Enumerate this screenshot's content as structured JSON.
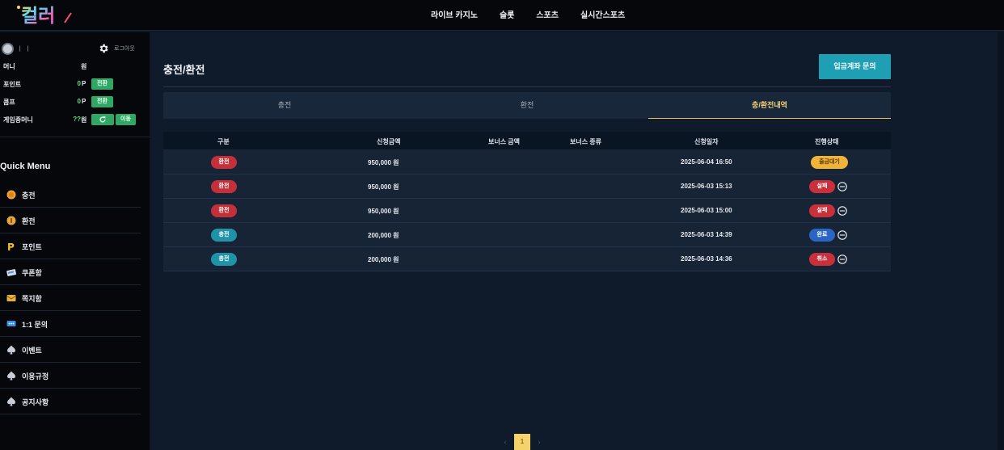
{
  "header": {
    "logo_text": "컬러",
    "nav": [
      "라이브 카지노",
      "슬롯",
      "스포츠",
      "실시간스포츠"
    ]
  },
  "sidebar": {
    "username": "ㅣ ㅣ",
    "logout": "로그아웃",
    "balances": [
      {
        "label": "머니",
        "value": "",
        "unit": "원"
      },
      {
        "label": "포인트",
        "value": "0",
        "unit": "P",
        "button": "전환"
      },
      {
        "label": "콤프",
        "value": "0",
        "unit": "P",
        "button": "전환"
      },
      {
        "label": "게임중머니",
        "value": "??",
        "unit": "원",
        "button": "이동"
      }
    ],
    "quick_menu_title": "Quick Menu",
    "quick_menu": [
      {
        "label": "충전",
        "icon": "coin-icon"
      },
      {
        "label": "환전",
        "icon": "coin-icon"
      },
      {
        "label": "포인트",
        "icon": "point-icon"
      },
      {
        "label": "쿠폰함",
        "icon": "coupon-icon"
      },
      {
        "label": "쪽지함",
        "icon": "message-icon"
      },
      {
        "label": "1:1 문의",
        "icon": "chat-icon"
      },
      {
        "label": "이벤트",
        "icon": "spade-icon"
      },
      {
        "label": "이용규정",
        "icon": "spade-icon"
      },
      {
        "label": "공지사항",
        "icon": "spade-icon"
      }
    ]
  },
  "main": {
    "title": "충전/환전",
    "inquiry_button": "입금계좌 문의",
    "tabs": [
      {
        "label": "충전",
        "active": false
      },
      {
        "label": "환전",
        "active": false
      },
      {
        "label": "충/환전내역",
        "active": true
      }
    ],
    "table": {
      "headers": [
        "구분",
        "신청금액",
        "보너스 금액",
        "보너스 종류",
        "신청일자",
        "진행상태"
      ],
      "rows": [
        {
          "type": "환전",
          "amount": "950,000 원",
          "bonus_amount": "",
          "bonus_type": "",
          "date": "2025-06-04 16:50",
          "status": "출금대기"
        },
        {
          "type": "환전",
          "amount": "950,000 원",
          "bonus_amount": "",
          "bonus_type": "",
          "date": "2025-06-03 15:13",
          "status": "실패"
        },
        {
          "type": "환전",
          "amount": "950,000 원",
          "bonus_amount": "",
          "bonus_type": "",
          "date": "2025-06-03 15:00",
          "status": "실패"
        },
        {
          "type": "충전",
          "amount": "200,000 원",
          "bonus_amount": "",
          "bonus_type": "",
          "date": "2025-06-03 14:39",
          "status": "완료"
        },
        {
          "type": "충전",
          "amount": "200,000 원",
          "bonus_amount": "",
          "bonus_type": "",
          "date": "2025-06-03 14:36",
          "status": "취소"
        }
      ]
    },
    "pagination": {
      "prev": "‹",
      "current": "1",
      "next": "›"
    }
  },
  "colors": {
    "accent": "#1e9fb4",
    "active_tab": "#f3d37a",
    "withdraw": "#c3303a",
    "deposit": "#1f93a8",
    "pending": "#f1b43a",
    "complete": "#2b65c4"
  }
}
